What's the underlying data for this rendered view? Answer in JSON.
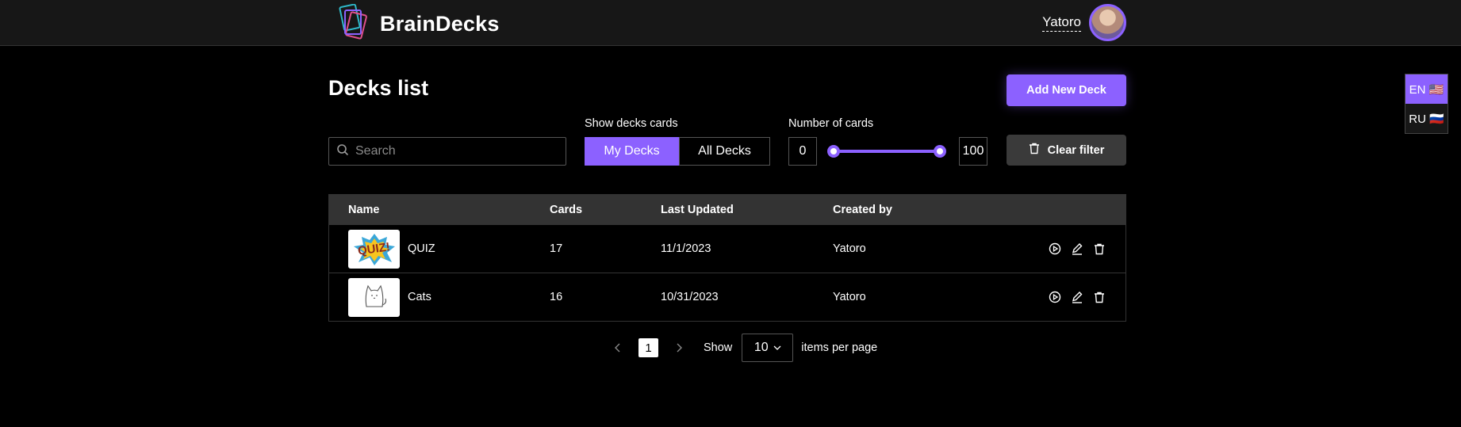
{
  "header": {
    "app_title": "BrainDecks",
    "user_name": "Yatoro"
  },
  "lang": {
    "options": [
      {
        "label": "EN 🇺🇸",
        "active": true
      },
      {
        "label": "RU 🇷🇺",
        "active": false
      }
    ]
  },
  "page": {
    "title": "Decks list",
    "add_button": "Add New Deck"
  },
  "filters": {
    "search_placeholder": "Search",
    "show_label": "Show decks cards",
    "my_decks": "My Decks",
    "all_decks": "All Decks",
    "cards_label": "Number of cards",
    "min": "0",
    "max": "100",
    "clear_button": "Clear filter"
  },
  "table": {
    "columns": [
      "Name",
      "Cards",
      "Last Updated",
      "Created by"
    ],
    "rows": [
      {
        "thumb": "QUIZ!",
        "name": "QUIZ",
        "cards": "17",
        "updated": "11/1/2023",
        "author": "Yatoro"
      },
      {
        "thumb": "cat",
        "name": "Cats",
        "cards": "16",
        "updated": "10/31/2023",
        "author": "Yatoro"
      }
    ]
  },
  "pagination": {
    "current_page": "1",
    "show_label": "Show",
    "per_page": "10",
    "items_label": "items per page"
  },
  "colors": {
    "accent": "#8c61ff",
    "header_bg": "#171717",
    "table_header_bg": "#333333"
  }
}
